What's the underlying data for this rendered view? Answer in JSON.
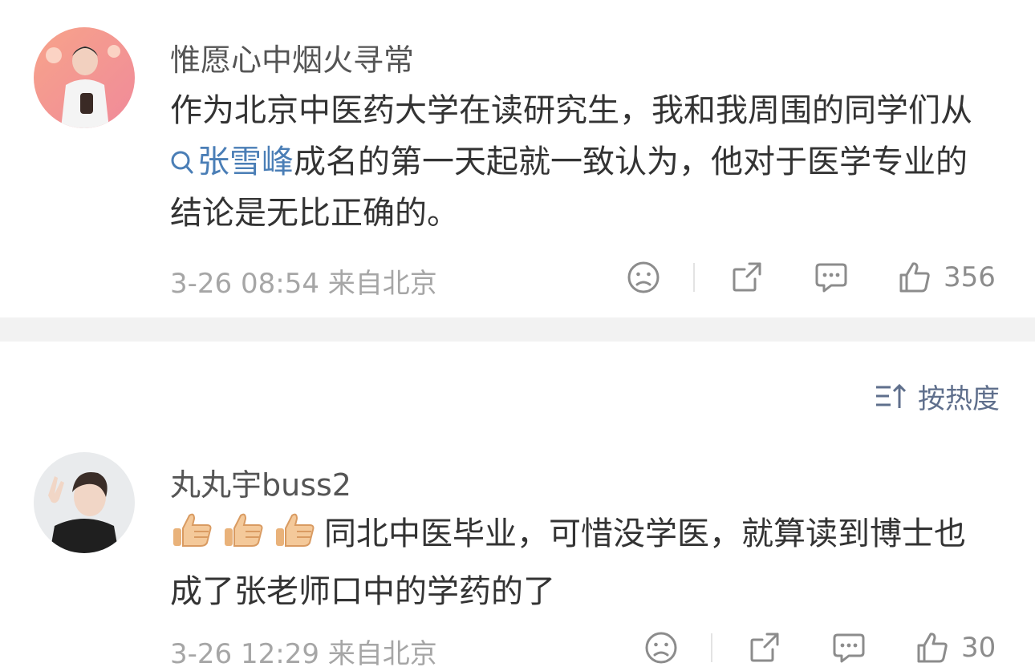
{
  "comments": [
    {
      "username": "惟愿心中烟火寻常",
      "avatar_icon": "user-avatar-photo",
      "text_before": "作为北京中医药大学在读研究生，我和我周围的同学们从",
      "topic": "张雪峰",
      "text_after": "成名的第一天起就一致认为，他对于医学专业的结论是无比正确的。",
      "meta": "3-26 08:54 来自北京",
      "likes": "356"
    },
    {
      "username": "丸丸宇buss2",
      "avatar_icon": "user-avatar-photo",
      "emoji_icon": "thumbs-up-emoji",
      "text": "同北中医毕业，可惜没学医，就算读到博士也成了张老师口中的学药的了",
      "meta": "3-26 12:29 来自北京",
      "likes": "30"
    }
  ],
  "sort": {
    "label": "按热度"
  },
  "colors": {
    "link": "#4a7eb6",
    "meta": "#a6a6a6",
    "divider": "#f2f2f2"
  }
}
